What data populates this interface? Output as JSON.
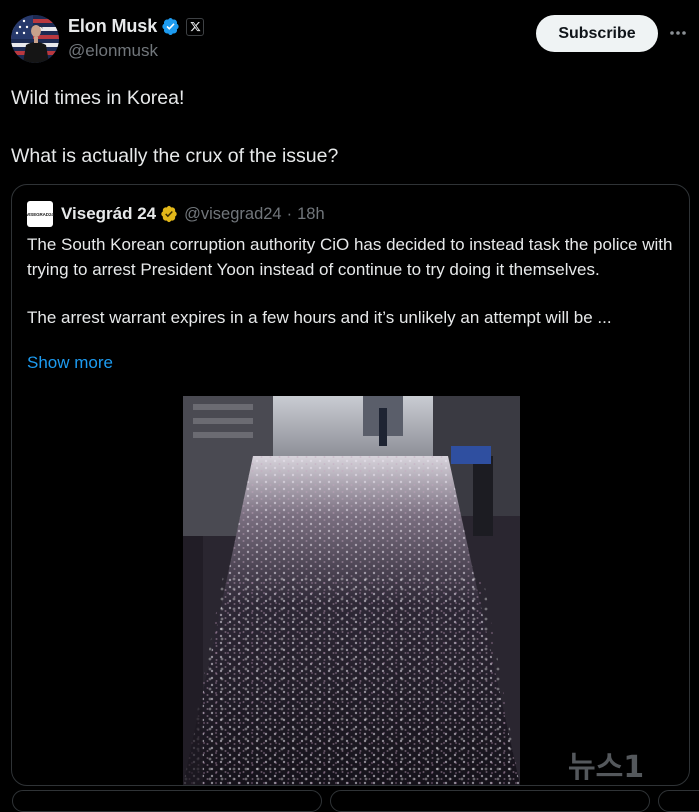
{
  "author": {
    "display_name": "Elon Musk",
    "handle": "@elonmusk",
    "subscribe_label": "Subscribe"
  },
  "post": {
    "lines": [
      "Wild times in Korea!",
      "What is actually the crux of the issue?"
    ]
  },
  "quote": {
    "avatar_text": "VISEGRAD24",
    "display_name": "Visegrád 24",
    "handle": "@visegrad24",
    "separator": "·",
    "time": "18h",
    "paragraphs": [
      "The South Korean corruption authority CiO has decided to instead task the police with trying to arrest President Yoon instead of continue to try doing it themselves.",
      "The arrest warrant expires in a few hours and it’s unlikely an attempt will be ..."
    ],
    "show_more_label": "Show more"
  },
  "icons": {
    "verified": "verified-badge-icon",
    "x_logo": "x-logo-icon",
    "more": "more-options-icon",
    "gold": "gold-verified-badge-icon"
  },
  "colors": {
    "background": "#000000",
    "text": "#e7e9ea",
    "secondary": "#71767b",
    "link": "#1d9bf0",
    "verified_blue": "#1d9bf0",
    "verified_gold": "#e2b719",
    "border": "#2f3336"
  },
  "watermark_text": "뉴스1"
}
